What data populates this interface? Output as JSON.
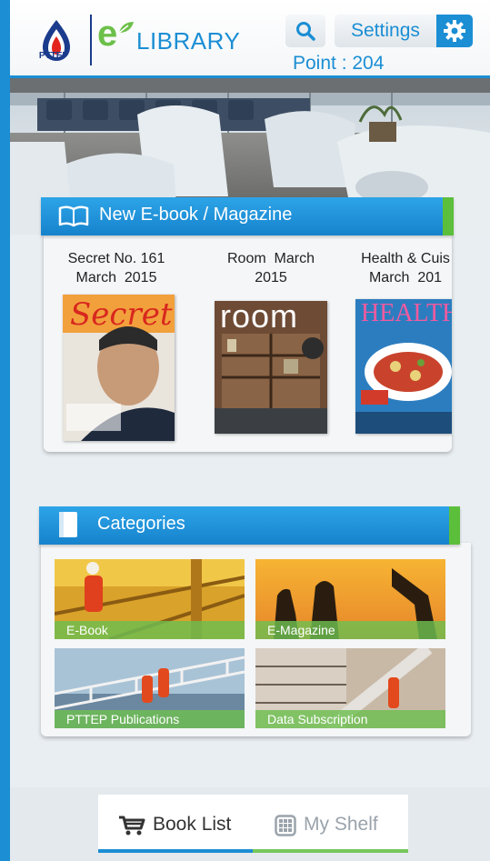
{
  "header": {
    "company": "PTTEP",
    "brand_e": "e",
    "brand_name": "LIBRARY",
    "settings_label": "Settings",
    "point_text": "Point : 204",
    "icons": {
      "search": "search-icon",
      "settings": "gear-icon"
    }
  },
  "new_section": {
    "title": "New E-book / Magazine",
    "icon": "open-book-icon",
    "books": [
      {
        "title": "Secret No. 161\nMarch  2015",
        "cover_name": "secret-cover",
        "cover_text": "Secret"
      },
      {
        "title": "Room  March\n2015",
        "cover_name": "room-cover",
        "cover_text": "room"
      },
      {
        "title": "Health & Cuis\nMarch  201",
        "cover_name": "health-cuisine-cover",
        "cover_text": "HEALTH"
      }
    ]
  },
  "categories": {
    "title": "Categories",
    "icon": "notebook-icon",
    "items": [
      {
        "label": "E-Book"
      },
      {
        "label": "E-Magazine"
      },
      {
        "label": "PTTEP  Publications"
      },
      {
        "label": "Data  Subscription"
      }
    ]
  },
  "tabs": {
    "book_list": "Book  List",
    "my_shelf": "My  Shelf"
  },
  "colors": {
    "primary_blue": "#1b8ed4",
    "accent_green": "#5cbf3c",
    "background": "#e9eef2"
  }
}
